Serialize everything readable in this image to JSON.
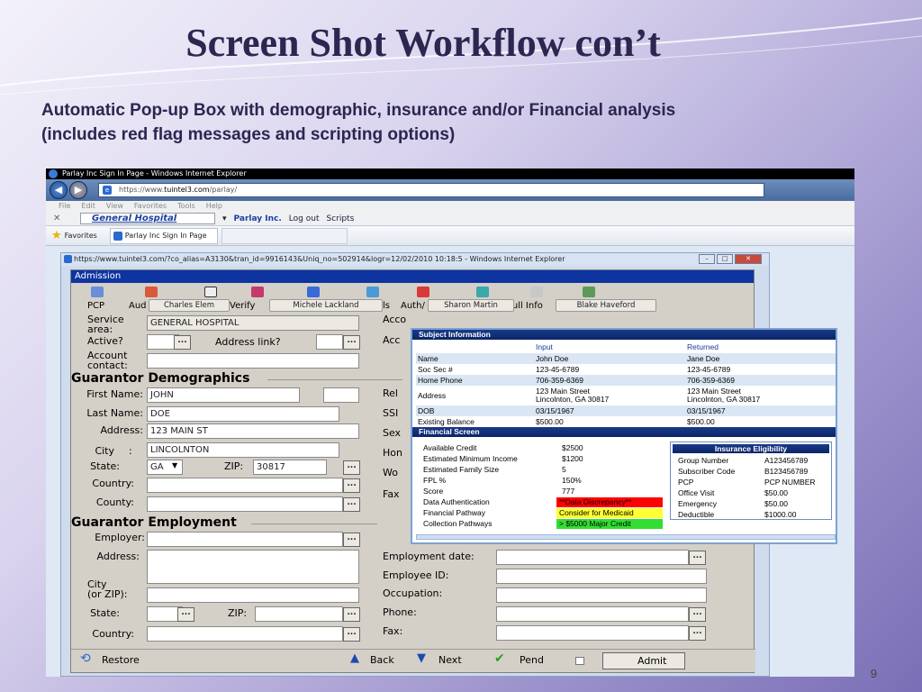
{
  "slide": {
    "title": "Screen Shot Workflow con’t",
    "subtitle_line1": "Automatic Pop-up Box with demographic, insurance and/or Financial analysis",
    "subtitle_line2": "(includes red flag messages and scripting options)",
    "page_number": "9"
  },
  "browser": {
    "window_title": "Parlay Inc Sign In Page - Windows Internet Explorer",
    "url_prefix": "https://www.",
    "url_domain": "tuintel3.com",
    "url_path": "/parlay/",
    "menu": [
      "File",
      "Edit",
      "View",
      "Favorites",
      "Tools",
      "Help"
    ],
    "toolbar": {
      "hospital": "General Hospital",
      "company": "Parlay Inc.",
      "logout": "Log out",
      "scripts": "Scripts"
    },
    "favorites": "Favorites",
    "tab": "Parlay Inc Sign In Page"
  },
  "popup": {
    "title": "https://www.tuintel3.com/?co_alias=A3130&tran_id=9916143&Uniq_no=502914&logr=12/02/2010 10:18:5 - Windows Internet Explorer",
    "app_title": "Admission",
    "tool_labels": {
      "pcp": "PCP",
      "aud": "Aud",
      "verify": "Verify",
      "is": "ls",
      "auth": "Auth/",
      "pull": "Pull Info"
    },
    "pills": {
      "p1": "Charles Elem",
      "p2": "Michele Lackland",
      "p3": "Sharon Martin",
      "p4": "Blake Haveford"
    },
    "labels": {
      "service_area_1": "Service",
      "service_area_2": "area:",
      "active": "Active?",
      "address_link": "Address link?",
      "account_contact_1": "Account",
      "account_contact_2": "contact:",
      "first_name": "First  Name:",
      "last_name": "Last Name:",
      "address": "Address:",
      "city": "City",
      "city_colon": ":",
      "state": "State:",
      "zip": "ZIP:",
      "country": "Country:",
      "county": "County:",
      "employer": "Employer:",
      "emp_address": "Address:",
      "emp_city_1": "City",
      "emp_city_2": "(or ZIP):",
      "emp_state": "State:",
      "emp_zip": "ZIP:",
      "emp_country": "Country:",
      "acc1": "Acco",
      "acc2": "Acc",
      "rel": "Rel",
      "ssi": "SSI",
      "sex": "Sex",
      "hon": "Hon",
      "wor": "Wo",
      "fax1": "Fax",
      "employment_date": "Employment date:",
      "employee_id": "Employee ID:",
      "occupation": "Occupation:",
      "phone": "Phone:",
      "fax": "Fax:"
    },
    "values": {
      "service_area": "GENERAL HOSPITAL",
      "first_name": "JOHN",
      "last_name": "DOE",
      "address": "123 MAIN ST",
      "city": "LINCOLNTON",
      "state": "GA",
      "zip": "30817"
    },
    "sections": {
      "guarantor_demo": "Guarantor Demographics",
      "guarantor_emp": "Guarantor Employment"
    },
    "bottom": {
      "restore": "Restore",
      "back": "Back",
      "next": "Next",
      "pend": "Pend",
      "admit": "Admit"
    }
  },
  "info": {
    "subject_header": "Subject Information",
    "col_input": "Input",
    "col_returned": "Returned",
    "rows": [
      {
        "label": "Name",
        "input": "John Doe",
        "returned": "Jane Doe"
      },
      {
        "label": "Soc Sec #",
        "input": "123-45-6789",
        "returned": "123-45-6789"
      },
      {
        "label": "Home Phone",
        "input": "706-359-6369",
        "returned": "706-359-6369"
      },
      {
        "label": "Address",
        "input": "123 Main Street",
        "input2": "Lincolnton, GA 30817",
        "returned": "123 Main Street",
        "returned2": "Lincolnton, GA 30817"
      },
      {
        "label": "DOB",
        "input": "03/15/1967",
        "returned": "03/15/1967"
      },
      {
        "label": "Existing Balance",
        "input": "$500.00",
        "returned": "$500.00"
      }
    ],
    "financial_header": "Financial Screen",
    "financial": [
      {
        "label": "Available Credit",
        "value": "$2500"
      },
      {
        "label": "Estimated Minimum Income",
        "value": "$1200"
      },
      {
        "label": "Estimated Family Size",
        "value": "5"
      },
      {
        "label": "FPL %",
        "value": "150%"
      },
      {
        "label": "Score",
        "value": "777"
      },
      {
        "label": "Data Authentication",
        "value": "**Data Discrepancy**"
      },
      {
        "label": "Financial Pathway",
        "value": "Consider for Medicaid"
      },
      {
        "label": "Collection Pathways",
        "value": "> $5000 Major Credit"
      }
    ],
    "flag_colors": {
      "discrepancy": "#ff0000",
      "medicaid": "#ffff33",
      "collection": "#33dd33"
    },
    "insurance_header": "Insurance Eligibility",
    "insurance": [
      {
        "label": "Group Number",
        "value": "A123456789"
      },
      {
        "label": "Subscriber Code",
        "value": "B123456789"
      },
      {
        "label": "PCP",
        "value": "PCP NUMBER"
      },
      {
        "label": "Office Visit",
        "value": "$50.00"
      },
      {
        "label": "Emergency",
        "value": "$50.00"
      },
      {
        "label": "Deductible",
        "value": "$1000.00"
      }
    ]
  }
}
